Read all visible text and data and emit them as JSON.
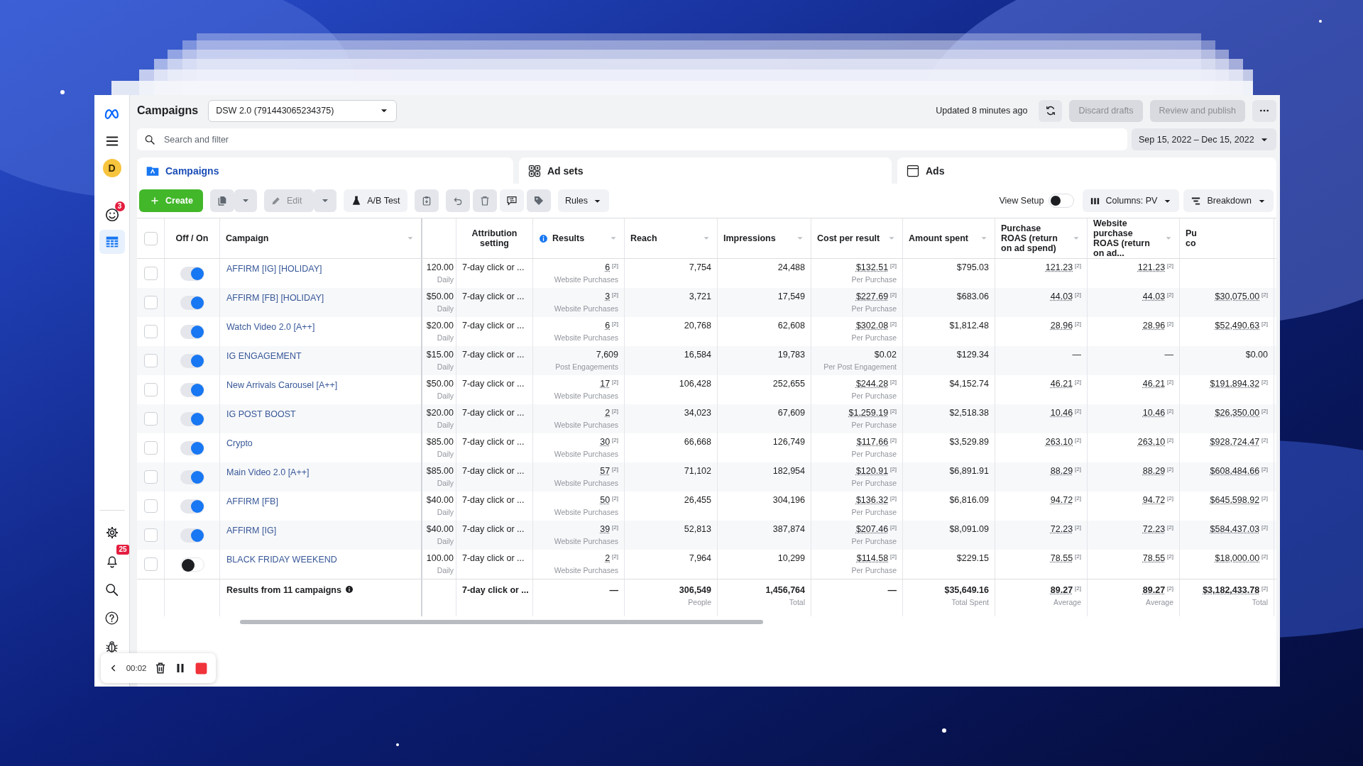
{
  "sidebar": {
    "top_items": [
      {
        "kind": "logo",
        "selected": false
      },
      {
        "kind": "menu",
        "selected": false
      },
      {
        "kind": "avatar",
        "label": "D",
        "selected": false
      },
      {
        "kind": "alerts",
        "badge": "3",
        "selected": false
      },
      {
        "kind": "table",
        "selected": true
      }
    ],
    "bottom_items": [
      {
        "kind": "settings",
        "selected": false
      },
      {
        "kind": "notifications",
        "badge": "25",
        "selected": false
      },
      {
        "kind": "search",
        "selected": false
      },
      {
        "kind": "help",
        "selected": false
      },
      {
        "kind": "bug",
        "selected": false
      }
    ]
  },
  "header": {
    "title": "Campaigns",
    "account": "DSW 2.0 (791443065234375)",
    "updated": "Updated 8 minutes ago",
    "buttons": [
      {
        "label": "Discard drafts",
        "disabled": true
      },
      {
        "label": "Review and publish",
        "disabled": true
      }
    ]
  },
  "search": {
    "placeholder": "Search and filter"
  },
  "date_range": "Sep 15, 2022 – Dec 15, 2022",
  "tabs": [
    {
      "kind": "campaigns",
      "label": "Campaigns",
      "selected": true
    },
    {
      "kind": "adsets",
      "label": "Ad sets",
      "selected": false
    },
    {
      "kind": "ads",
      "label": "Ads",
      "selected": false
    }
  ],
  "toolbar": {
    "items": [
      {
        "kind": "create",
        "label": "Create",
        "disabled": false
      },
      {
        "kind": "duplicate",
        "disabled": true
      },
      {
        "kind": "caret",
        "disabled": true
      },
      {
        "kind": "edit",
        "label": "Edit",
        "disabled": true
      },
      {
        "kind": "caret",
        "disabled": true
      },
      {
        "kind": "abtest",
        "label": "A/B Test",
        "disabled": false
      },
      {
        "kind": "clipboard",
        "disabled": true
      },
      {
        "kind": "undo",
        "disabled": true
      },
      {
        "kind": "delete",
        "disabled": true
      },
      {
        "kind": "compare",
        "disabled": false
      },
      {
        "kind": "tag",
        "disabled": true
      },
      {
        "kind": "rules",
        "label": "Rules",
        "disabled": false
      }
    ]
  },
  "view_controls": {
    "view_setup": {
      "label": "View Setup",
      "on": false
    },
    "columns": "Columns: PV",
    "breakdown": "Breakdown"
  },
  "table": {
    "select_all": {
      "checked": false
    },
    "fixed_columns": [
      {
        "kind": "select"
      },
      {
        "kind": "toggle",
        "label": "Off / On",
        "sort_menu": false
      },
      {
        "kind": "name",
        "label": "Campaign",
        "sort_menu": true
      }
    ],
    "columns": [
      {
        "kind": "budget"
      },
      {
        "kind": "text",
        "label": "Attribution setting",
        "sort_menu": false
      },
      {
        "kind": "metric",
        "label": "Results",
        "info": true,
        "sort_menu": true
      },
      {
        "kind": "metric",
        "label": "Reach",
        "sort_menu": true
      },
      {
        "kind": "metric",
        "label": "Impressions",
        "sort_menu": true
      },
      {
        "kind": "metric",
        "label": "Cost per result",
        "sort_menu": true
      },
      {
        "kind": "metric",
        "label": "Amount spent",
        "sort_menu": true
      },
      {
        "kind": "metric",
        "label": "Purchase ROAS (return on ad spend)",
        "sort_menu": true
      },
      {
        "kind": "metric",
        "label": "Website purchase ROAS (return on ad...",
        "sort_menu": true
      },
      {
        "kind": "metric",
        "label": "Pu\nco",
        "sort_menu": false
      }
    ],
    "rows": [
      {
        "checked": false,
        "on": true,
        "name": "AFFIRM [IG] [HOLIDAY]",
        "cells": [
          {
            "value": "120.00",
            "sub": "Daily"
          },
          {
            "value": "7-day click or ..."
          },
          {
            "value": "6",
            "note": "[2]",
            "sub": "Website Purchases"
          },
          {
            "value": "7,754"
          },
          {
            "value": "24,488"
          },
          {
            "value": "$132.51",
            "note": "[2]",
            "sub": "Per Purchase"
          },
          {
            "value": "$795.03"
          },
          {
            "value": "121.23",
            "note": "[2]"
          },
          {
            "value": "121.23",
            "note": "[2]"
          },
          null
        ]
      },
      {
        "checked": false,
        "on": true,
        "name": "AFFIRM [FB] [HOLIDAY]",
        "cells": [
          {
            "value": "$50.00",
            "sub": "Daily"
          },
          {
            "value": "7-day click or ..."
          },
          {
            "value": "3",
            "note": "[2]",
            "sub": "Website Purchases"
          },
          {
            "value": "3,721"
          },
          {
            "value": "17,549"
          },
          {
            "value": "$227.69",
            "note": "[2]",
            "sub": "Per Purchase"
          },
          {
            "value": "$683.06"
          },
          {
            "value": "44.03",
            "note": "[2]"
          },
          {
            "value": "44.03",
            "note": "[2]"
          },
          {
            "value": "$30,075.00",
            "note": "[2]"
          }
        ]
      },
      {
        "checked": false,
        "on": true,
        "name": "Watch Video 2.0 [A++]",
        "cells": [
          {
            "value": "$20.00",
            "sub": "Daily"
          },
          {
            "value": "7-day click or ..."
          },
          {
            "value": "6",
            "note": "[2]",
            "sub": "Website Purchases"
          },
          {
            "value": "20,768"
          },
          {
            "value": "62,608"
          },
          {
            "value": "$302.08",
            "note": "[2]",
            "sub": "Per Purchase"
          },
          {
            "value": "$1,812.48"
          },
          {
            "value": "28.96",
            "note": "[2]"
          },
          {
            "value": "28.96",
            "note": "[2]"
          },
          {
            "value": "$52,490.63",
            "note": "[2]"
          }
        ]
      },
      {
        "checked": false,
        "on": true,
        "name": "IG ENGAGEMENT",
        "cells": [
          {
            "value": "$15.00",
            "sub": "Daily"
          },
          {
            "value": "7-day click or ..."
          },
          {
            "value": "7,609",
            "sub": "Post Engagements"
          },
          {
            "value": "16,584"
          },
          {
            "value": "19,783"
          },
          {
            "value": "$0.02",
            "sub": "Per Post Engagement"
          },
          {
            "value": "$129.34"
          },
          {
            "value": "—"
          },
          {
            "value": "—"
          },
          {
            "value": "$0.00"
          }
        ]
      },
      {
        "checked": false,
        "on": true,
        "name": "New Arrivals Carousel [A++]",
        "cells": [
          {
            "value": "$50.00",
            "sub": "Daily"
          },
          {
            "value": "7-day click or ..."
          },
          {
            "value": "17",
            "note": "[2]",
            "sub": "Website Purchases"
          },
          {
            "value": "106,428"
          },
          {
            "value": "252,655"
          },
          {
            "value": "$244.28",
            "note": "[2]",
            "sub": "Per Purchase"
          },
          {
            "value": "$4,152.74"
          },
          {
            "value": "46.21",
            "note": "[2]"
          },
          {
            "value": "46.21",
            "note": "[2]"
          },
          {
            "value": "$191,894.32",
            "note": "[2]"
          }
        ]
      },
      {
        "checked": false,
        "on": true,
        "name": "IG POST BOOST",
        "cells": [
          {
            "value": "$20.00",
            "sub": "Daily"
          },
          {
            "value": "7-day click or ..."
          },
          {
            "value": "2",
            "note": "[2]",
            "sub": "Website Purchases"
          },
          {
            "value": "34,023"
          },
          {
            "value": "67,609"
          },
          {
            "value": "$1,259.19",
            "note": "[2]",
            "sub": "Per Purchase"
          },
          {
            "value": "$2,518.38"
          },
          {
            "value": "10.46",
            "note": "[2]"
          },
          {
            "value": "10.46",
            "note": "[2]"
          },
          {
            "value": "$26,350.00",
            "note": "[2]"
          }
        ]
      },
      {
        "checked": false,
        "on": true,
        "name": "Crypto",
        "cells": [
          {
            "value": "$85.00",
            "sub": "Daily"
          },
          {
            "value": "7-day click or ..."
          },
          {
            "value": "30",
            "note": "[2]",
            "sub": "Website Purchases"
          },
          {
            "value": "66,668"
          },
          {
            "value": "126,749"
          },
          {
            "value": "$117.66",
            "note": "[2]",
            "sub": "Per Purchase"
          },
          {
            "value": "$3,529.89"
          },
          {
            "value": "263.10",
            "note": "[2]"
          },
          {
            "value": "263.10",
            "note": "[2]"
          },
          {
            "value": "$928,724.47",
            "note": "[2]"
          }
        ]
      },
      {
        "checked": false,
        "on": true,
        "name": "Main Video 2.0 [A++]",
        "cells": [
          {
            "value": "$85.00",
            "sub": "Daily"
          },
          {
            "value": "7-day click or ..."
          },
          {
            "value": "57",
            "note": "[2]",
            "sub": "Website Purchases"
          },
          {
            "value": "71,102"
          },
          {
            "value": "182,954"
          },
          {
            "value": "$120.91",
            "note": "[2]",
            "sub": "Per Purchase"
          },
          {
            "value": "$6,891.91"
          },
          {
            "value": "88.29",
            "note": "[2]"
          },
          {
            "value": "88.29",
            "note": "[2]"
          },
          {
            "value": "$608,484.66",
            "note": "[2]"
          }
        ]
      },
      {
        "checked": false,
        "on": true,
        "name": "AFFIRM [FB]",
        "cells": [
          {
            "value": "$40.00",
            "sub": "Daily"
          },
          {
            "value": "7-day click or ..."
          },
          {
            "value": "50",
            "note": "[2]",
            "sub": "Website Purchases"
          },
          {
            "value": "26,455"
          },
          {
            "value": "304,196"
          },
          {
            "value": "$136.32",
            "note": "[2]",
            "sub": "Per Purchase"
          },
          {
            "value": "$6,816.09"
          },
          {
            "value": "94.72",
            "note": "[2]"
          },
          {
            "value": "94.72",
            "note": "[2]"
          },
          {
            "value": "$645,598.92",
            "note": "[2]"
          }
        ]
      },
      {
        "checked": false,
        "on": true,
        "name": "AFFIRM [IG]",
        "cells": [
          {
            "value": "$40.00",
            "sub": "Daily"
          },
          {
            "value": "7-day click or ..."
          },
          {
            "value": "39",
            "note": "[2]",
            "sub": "Website Purchases"
          },
          {
            "value": "52,813"
          },
          {
            "value": "387,874"
          },
          {
            "value": "$207.46",
            "note": "[2]",
            "sub": "Per Purchase"
          },
          {
            "value": "$8,091.09"
          },
          {
            "value": "72.23",
            "note": "[2]"
          },
          {
            "value": "72.23",
            "note": "[2]"
          },
          {
            "value": "$584,437.03",
            "note": "[2]"
          }
        ]
      },
      {
        "checked": false,
        "on": false,
        "name": "BLACK FRIDAY WEEKEND",
        "cells": [
          {
            "value": "100.00",
            "sub": "Daily"
          },
          {
            "value": "7-day click or ..."
          },
          {
            "value": "2",
            "note": "[2]",
            "sub": "Website Purchases"
          },
          {
            "value": "7,964"
          },
          {
            "value": "10,299"
          },
          {
            "value": "$114.58",
            "note": "[2]",
            "sub": "Per Purchase"
          },
          {
            "value": "$229.15"
          },
          {
            "value": "78.55",
            "note": "[2]"
          },
          {
            "value": "78.55",
            "note": "[2]"
          },
          {
            "value": "$18,000.00",
            "note": "[2]"
          }
        ]
      }
    ],
    "total": {
      "label": "Results from 11 campaigns",
      "cells": [
        null,
        {
          "value": "7-day click or ..."
        },
        {
          "value": "—"
        },
        {
          "value": "306,549",
          "sub": "People"
        },
        {
          "value": "1,456,764",
          "sub": "Total"
        },
        {
          "value": "—"
        },
        {
          "value": "$35,649.16",
          "sub": "Total Spent"
        },
        {
          "value": "89.27",
          "note": "[2]",
          "sub": "Average"
        },
        {
          "value": "89.27",
          "note": "[2]",
          "sub": "Average"
        },
        {
          "value": "$3,182,433.78",
          "note": "[2]",
          "sub": "Total"
        }
      ]
    }
  },
  "recorder": {
    "time": "00:02"
  }
}
